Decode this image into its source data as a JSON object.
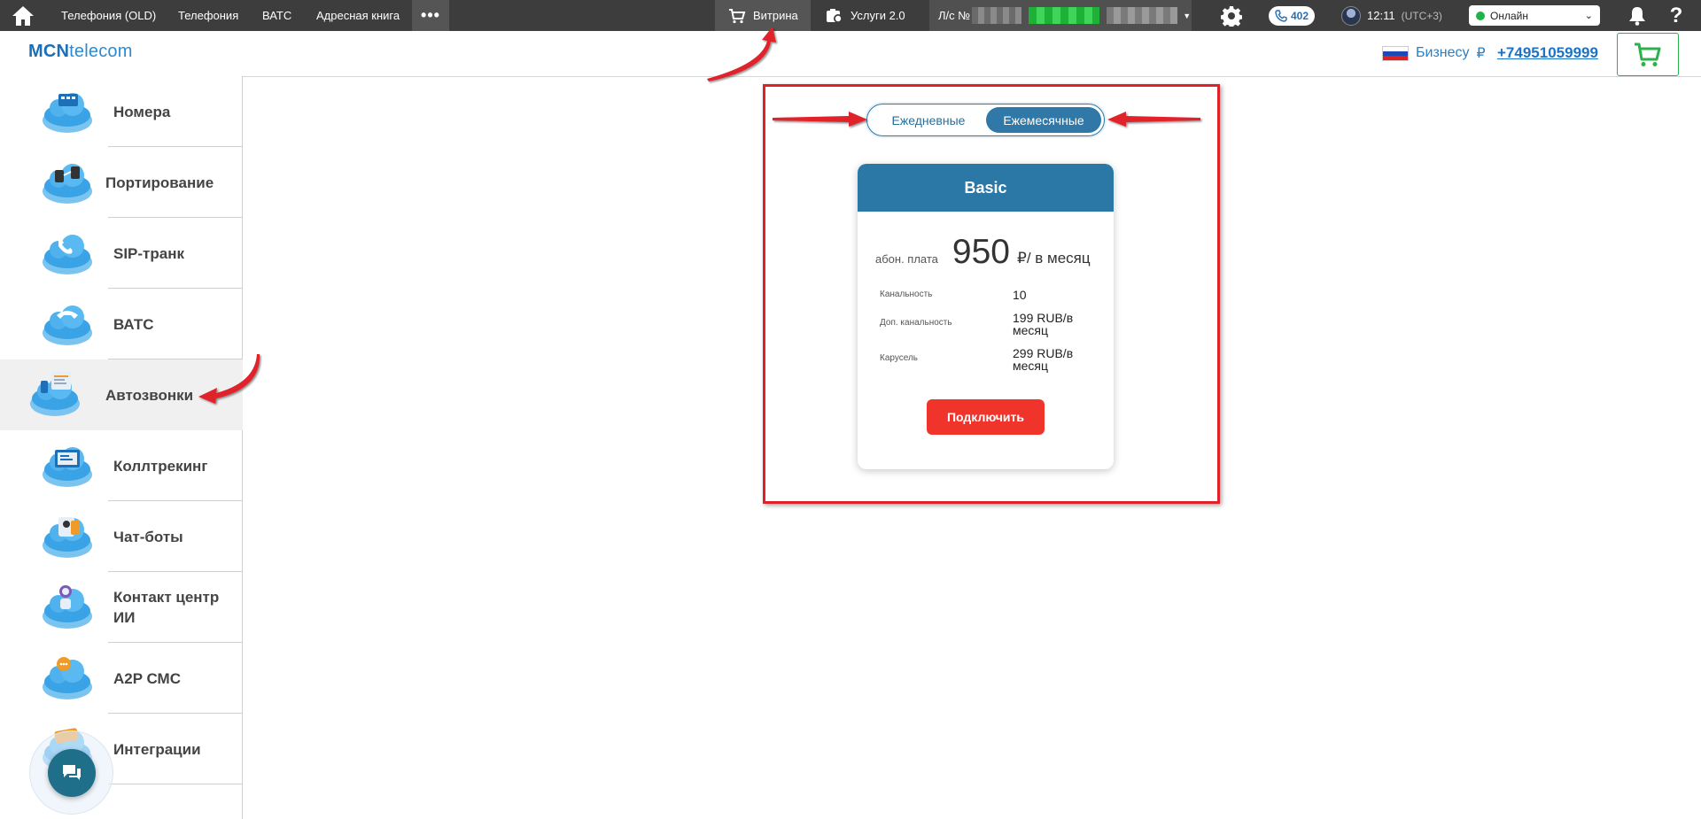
{
  "topbar": {
    "nav": [
      "Телефония (OLD)",
      "Телефония",
      "ВАТС",
      "Адресная книга"
    ],
    "more": "•••",
    "shop_label": "Витрина",
    "services_label": "Услуги 2.0",
    "account_prefix": "Л/с №",
    "calls_count": "402",
    "time": "12:11",
    "timezone": "(UTC+3)",
    "status": "Онлайн"
  },
  "header": {
    "logo_bold": "MCN",
    "logo_rest": "telecom",
    "tariff_plan": "Бизнесу",
    "currency_symbol": "₽",
    "phone": "+74951059999"
  },
  "sidebar": {
    "items": [
      {
        "label": "Номера",
        "icon": "numbers-cloud-icon"
      },
      {
        "label": "Портирование",
        "icon": "porting-cloud-icon"
      },
      {
        "label": "SIP-транк",
        "icon": "sip-trunk-cloud-icon"
      },
      {
        "label": "ВАТС",
        "icon": "vats-cloud-icon"
      },
      {
        "label": "Автозвонки",
        "icon": "autocall-cloud-icon"
      },
      {
        "label": "Коллтрекинг",
        "icon": "calltracking-cloud-icon"
      },
      {
        "label": "Чат-боты",
        "icon": "chatbot-cloud-icon"
      },
      {
        "label": "Контакт центр ИИ",
        "icon": "ai-contact-center-cloud-icon"
      },
      {
        "label": "A2P СМС",
        "icon": "a2p-sms-cloud-icon"
      },
      {
        "label": "Интеграции",
        "icon": "integrations-api-cloud-icon"
      }
    ]
  },
  "billing_toggle": {
    "daily": "Ежедневные",
    "monthly": "Ежемесячные",
    "selected": "monthly"
  },
  "tariff": {
    "name": "Basic",
    "fee_label": "абон. плата",
    "price": "950",
    "price_unit": "₽/ в месяц",
    "features": [
      {
        "name": "Канальность",
        "value": "10"
      },
      {
        "name": "Доп. канальность",
        "value": "199 RUB/в месяц"
      },
      {
        "name": "Карусель",
        "value": "299 RUB/в месяц"
      }
    ],
    "connect_label": "Подключить"
  },
  "colors": {
    "topbar_bg": "#3d3d3d",
    "brand_blue": "#2b78a6",
    "connect_red": "#f0342b",
    "highlight_red": "#e0202a",
    "online_green": "#21b24b"
  }
}
